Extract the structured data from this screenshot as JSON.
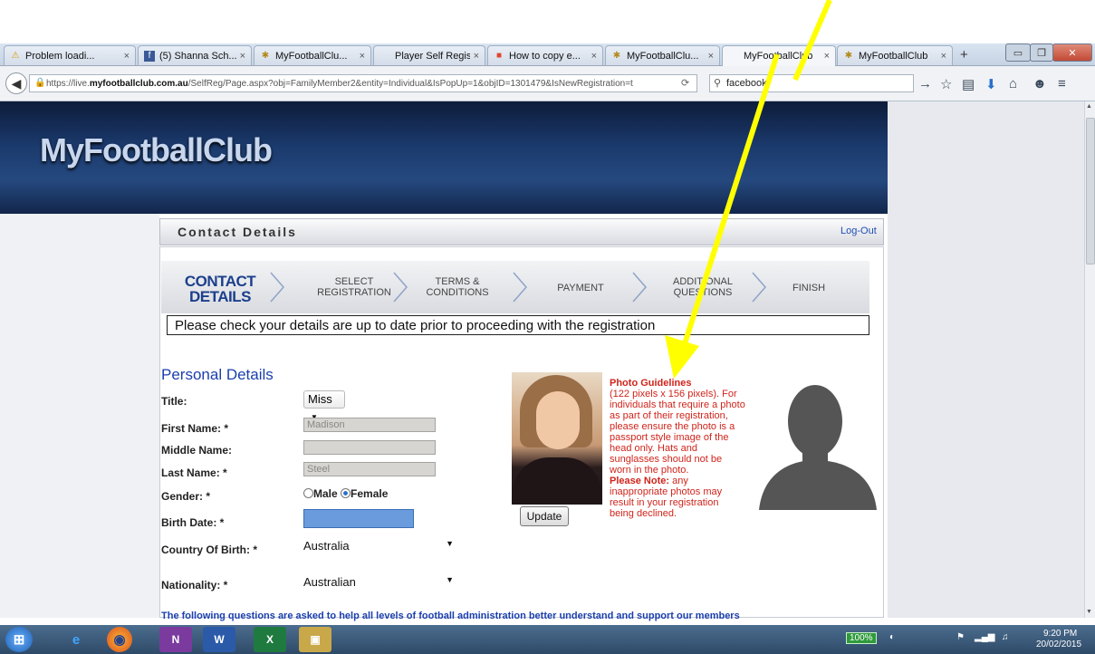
{
  "browser": {
    "tabs": [
      {
        "label": "Problem loadi...",
        "icon": "warning-icon"
      },
      {
        "label": "(5) Shanna Sch...",
        "icon": "facebook-icon"
      },
      {
        "label": "MyFootballClu...",
        "icon": "club-icon"
      },
      {
        "label": "Player Self Registra...",
        "icon": "page-icon"
      },
      {
        "label": "How to copy e...",
        "icon": "microsoft-icon"
      },
      {
        "label": "MyFootballClu...",
        "icon": "club-icon"
      },
      {
        "label": "MyFootballClub",
        "icon": "page-icon"
      },
      {
        "label": "MyFootballClub",
        "icon": "club-icon"
      }
    ],
    "new_tab": "+",
    "close_glyph": "×",
    "url_prefix": "https://live.",
    "url_host": "myfootballclub.com.au",
    "url_rest": "/SelfReg/Page.aspx?obj=FamilyMember2&entity=Individual&IsPopUp=1&objID=1301479&IsNewRegistration=t",
    "search_value": "facebook"
  },
  "site": {
    "logo_text": "MyFootballClub",
    "section_title": "Contact Details",
    "logout": "Log-Out"
  },
  "steps": [
    {
      "l1": "CONTACT",
      "l2": "DETAILS",
      "current": true
    },
    {
      "l1": "SELECT",
      "l2": "REGISTRATION"
    },
    {
      "l1": "TERMS &",
      "l2": "CONDITIONS"
    },
    {
      "l1": "PAYMENT",
      "l2": ""
    },
    {
      "l1": "ADDITIONAL",
      "l2": "QUESTIONS"
    },
    {
      "l1": "FINISH",
      "l2": ""
    }
  ],
  "notice": "Please check your details are up to date prior to proceeding with the registration",
  "personal": {
    "heading": "Personal Details",
    "title_label": "Title:",
    "title_value": "Miss",
    "first_name_label": "First Name: *",
    "first_name_value": "Madison",
    "middle_name_label": "Middle Name:",
    "middle_name_value": "",
    "last_name_label": "Last Name: *",
    "last_name_value": "Steel",
    "gender_label": "Gender: *",
    "gender_male": "Male",
    "gender_female": "Female",
    "gender_selected": "Female",
    "birth_date_label": "Birth Date: *",
    "country_label": "Country Of Birth: *",
    "country_value": "Australia",
    "nationality_label": "Nationality: *",
    "nationality_value": "Australian"
  },
  "photo": {
    "update_button": "Update",
    "guide_title": "Photo Guidelines",
    "guide_body": "(122 pixels x 156 pixels). For individuals that require a photo as part of their registration, please ensure the photo is a passport style image of the head only. Hats and sunglasses should not be worn in the photo.",
    "note_label": "Please Note:",
    "note_body": " any inappropriate photos may result in your registration being declined."
  },
  "footer_question": "The following questions are asked to help all levels of football administration better understand and support our members",
  "taskbar": {
    "battery": "100%",
    "time": "9:20 PM",
    "date": "20/02/2015"
  },
  "colors": {
    "arrow": "#ffff00",
    "link": "#1b3fae",
    "guide": "#d0241b"
  }
}
